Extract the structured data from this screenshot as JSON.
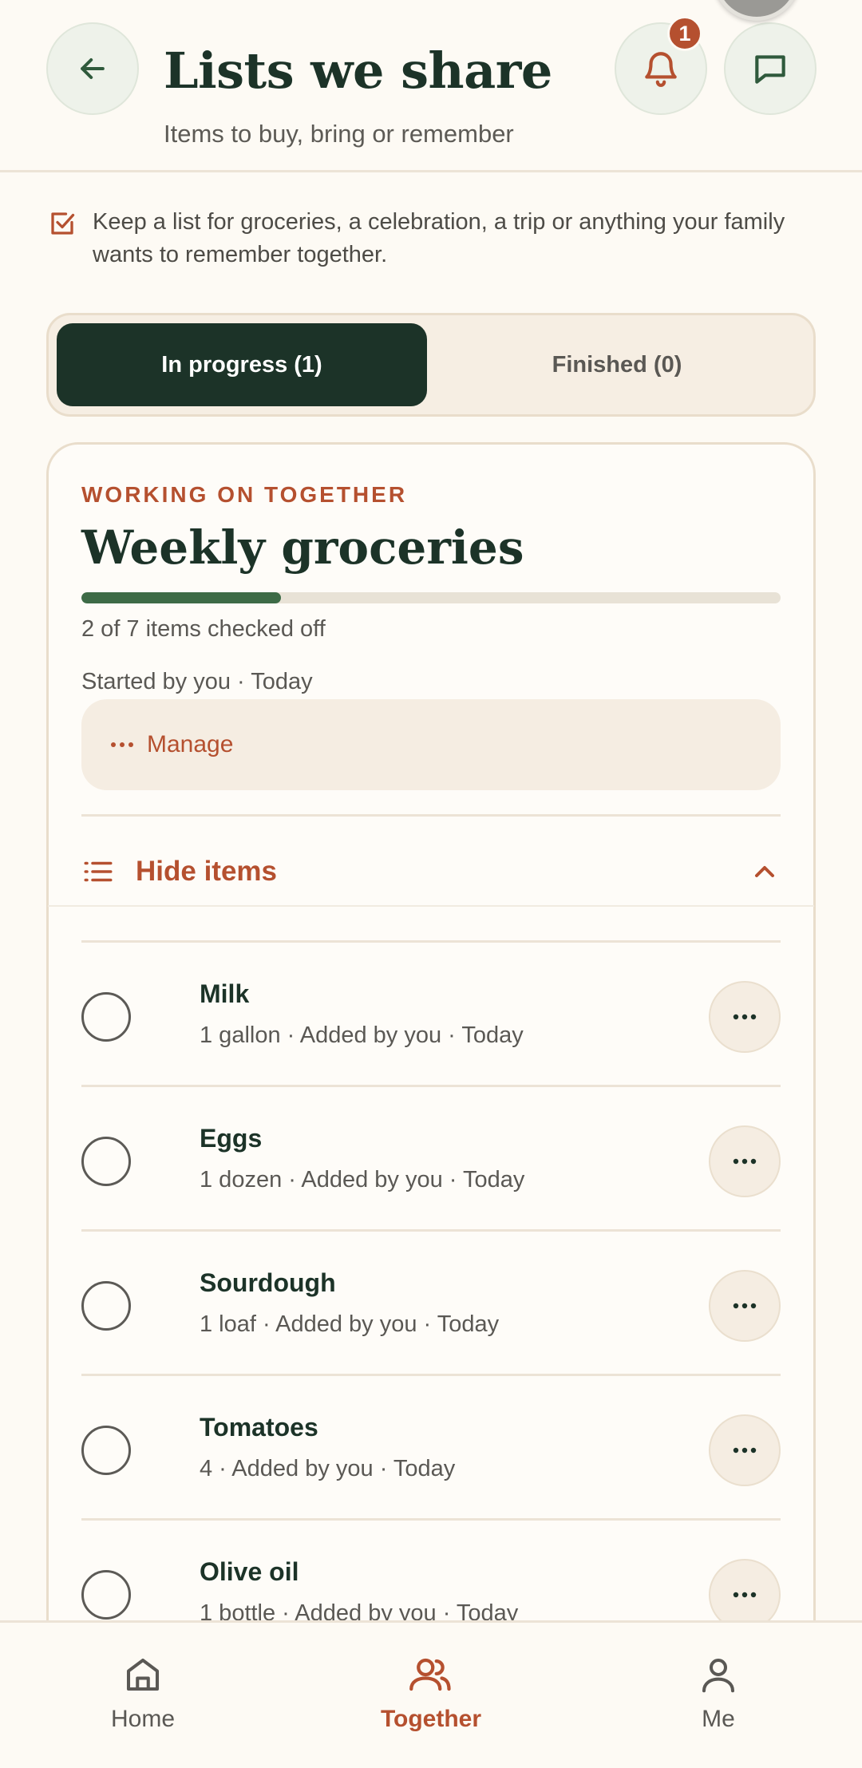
{
  "header": {
    "title": "Lists we share",
    "subtitle": "Items to buy, bring or remember",
    "notification_count": "1"
  },
  "info": {
    "text": "Keep a list for groceries, a celebration, a trip or anything your family wants to remember together."
  },
  "tabs": {
    "in_progress": "In progress (1)",
    "finished": "Finished (0)"
  },
  "list": {
    "eyebrow": "WORKING ON TOGETHER",
    "title": "Weekly groceries",
    "progress_fraction": 0.2857,
    "progress_text": "2 of 7 items checked off",
    "started": "Started by you · Today",
    "manage_label": "Manage",
    "hide_items_label": "Hide items"
  },
  "items": [
    {
      "name": "Milk",
      "meta": "1 gallon · Added by you · Today"
    },
    {
      "name": "Eggs",
      "meta": "1 dozen · Added by you · Today"
    },
    {
      "name": "Sourdough",
      "meta": "1 loaf · Added by you · Today"
    },
    {
      "name": "Tomatoes",
      "meta": "4 · Added by you · Today"
    },
    {
      "name": "Olive oil",
      "meta": "1 bottle · Added by you · Today"
    }
  ],
  "nav": {
    "home": "Home",
    "together": "Together",
    "me": "Me"
  },
  "colors": {
    "accent": "#b5502f",
    "primary": "#1c3328",
    "progress": "#3d6b47",
    "background": "#fdfaf4"
  }
}
